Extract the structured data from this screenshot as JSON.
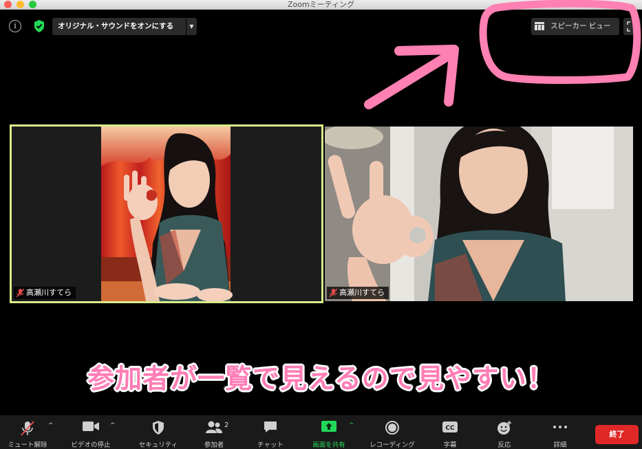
{
  "window": {
    "title": "Zoomミーティング"
  },
  "top_bar": {
    "audio_button_label": "オリジナル・サウンドをオンにする",
    "view_button_label": "スピーカー ビュー"
  },
  "participants": [
    {
      "name": "高瀬川すてら",
      "active_speaker": true
    },
    {
      "name": "高瀬川すてら",
      "active_speaker": false
    }
  ],
  "annotation": {
    "caption": "参加者が一覧で見えるので見やすい！",
    "color": "#ff7eb6"
  },
  "toolbar": {
    "unmute_label": "ミュート解除",
    "stop_video_label": "ビデオの停止",
    "security_label": "セキュリティ",
    "participants_label": "参加者",
    "participants_count": "2",
    "chat_label": "チャット",
    "share_label": "画面を共有",
    "record_label": "レコーディング",
    "captions_label": "字幕",
    "reactions_label": "反応",
    "more_label": "詳細",
    "end_label": "終了"
  },
  "colors": {
    "active_speaker_border": "#d9ec89",
    "share_green": "#23d959",
    "end_red": "#e02828",
    "security_green": "#23d959"
  }
}
